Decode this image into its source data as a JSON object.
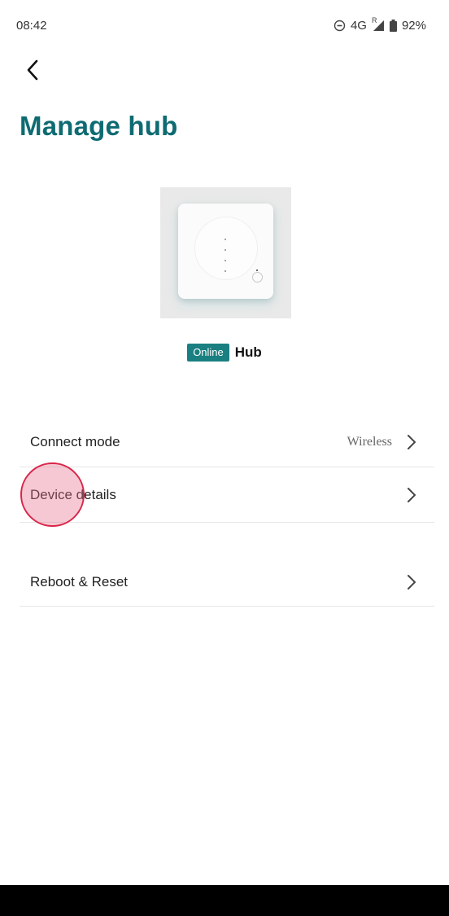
{
  "status_bar": {
    "time": "08:42",
    "network": "4G",
    "roaming": "R",
    "battery": "92%"
  },
  "header": {
    "back_icon": "back-arrow-icon",
    "title": "Manage hub"
  },
  "device": {
    "status": "Online",
    "name": "Hub",
    "accent_color": "#1a7f80"
  },
  "menu": [
    {
      "label": "Connect mode",
      "value": "Wireless"
    },
    {
      "label": "Device details",
      "value": ""
    },
    {
      "label": "Reboot & Reset",
      "value": ""
    }
  ],
  "colors": {
    "title": "#0e6b72",
    "touch_indicator": "#d8264a"
  }
}
